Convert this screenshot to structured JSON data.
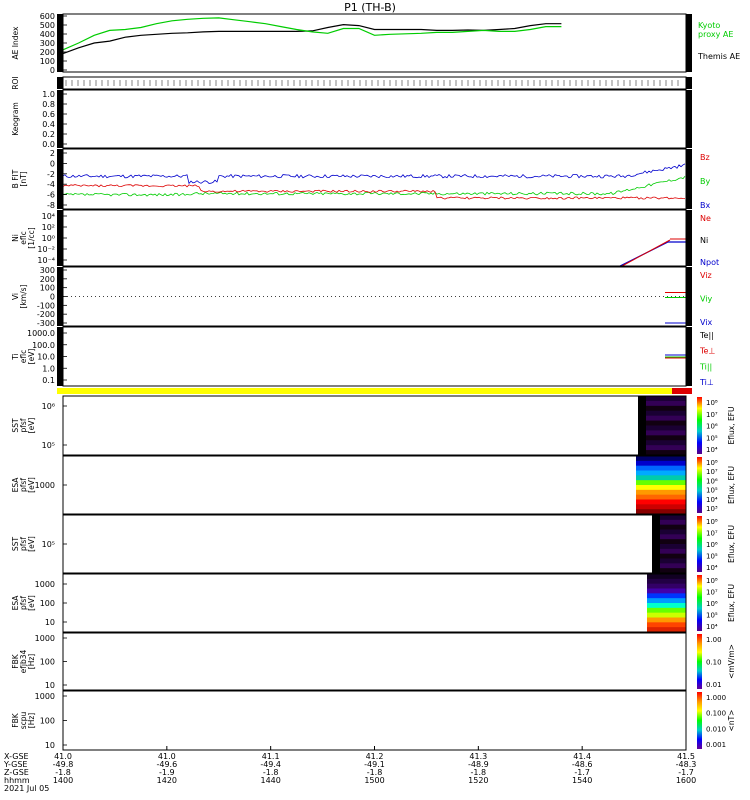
{
  "title": "P1 (TH-B)",
  "colors": {
    "black": "#000000",
    "green": "#00cc00",
    "red": "#dd0000",
    "blue": "#0000cc",
    "yellow": "#ffff00"
  },
  "chart_data": [
    {
      "type": "line",
      "panel": "ae",
      "ylabel": "AE Index",
      "yticks": [
        "600",
        "500",
        "400",
        "300",
        "200",
        "100",
        "0"
      ],
      "ylim": [
        0,
        600
      ],
      "x": [
        1400,
        1405,
        1410,
        1415,
        1420,
        1425,
        1430,
        1435,
        1440,
        1445,
        1450,
        1455,
        1460,
        1465,
        1470,
        1475,
        1480,
        1485,
        1490,
        1495,
        1500,
        1505,
        1510,
        1515,
        1520,
        1525,
        1530,
        1535,
        1540,
        1545,
        1550,
        1555,
        1560
      ],
      "series": [
        {
          "name": "Themis AE",
          "values": [
            190,
            250,
            300,
            320,
            360,
            380,
            390,
            400,
            405,
            415,
            420,
            420,
            420,
            420,
            420,
            420,
            425,
            460,
            490,
            480,
            440,
            440,
            440,
            440,
            430,
            430,
            435,
            430,
            440,
            450,
            480,
            500,
            500
          ]
        },
        {
          "name": "Kyoto proxy AE",
          "values": [
            230,
            300,
            380,
            430,
            440,
            460,
            500,
            530,
            545,
            555,
            560,
            540,
            520,
            500,
            470,
            440,
            415,
            400,
            450,
            450,
            380,
            390,
            395,
            400,
            410,
            410,
            420,
            430,
            420,
            420,
            440,
            470,
            470
          ]
        }
      ],
      "legend": [
        "Kyoto",
        "proxy AE",
        "Themis AE"
      ]
    },
    {
      "type": "bar",
      "panel": "roi",
      "ylabel": "ROI"
    },
    {
      "type": "heatmap",
      "panel": "keogram",
      "ylabel": "Keogram",
      "yticks": [
        "1.0",
        "0.8",
        "0.6",
        "0.4",
        "0.2",
        "0.0"
      ]
    },
    {
      "type": "line",
      "panel": "bfield",
      "ylabel": "B FIT",
      "yunit": "[nT]",
      "yticks": [
        "2",
        "0",
        "-2",
        "-4",
        "-6",
        "-8"
      ],
      "ylim": [
        -8,
        2
      ],
      "legend": [
        "Bz",
        "By",
        "Bx"
      ]
    },
    {
      "type": "line",
      "panel": "density",
      "ylabel": "Ni",
      "ysub": "eflc",
      "yunit": "[1/cc]",
      "yticks": [
        "10⁴",
        "10²",
        "10⁰",
        "10⁻²",
        "10⁻⁴"
      ],
      "legend": [
        "Ne",
        "Ni",
        "Npot"
      ]
    },
    {
      "type": "line",
      "panel": "velocity",
      "ylabel": "Vi",
      "yunit": "[km/s]",
      "yticks": [
        "300",
        "200",
        "100",
        "0",
        "-100",
        "-200",
        "-300"
      ],
      "ylim": [
        -300,
        300
      ],
      "legend": [
        "Viz",
        "Viy",
        "Vix"
      ]
    },
    {
      "type": "line",
      "panel": "temperature",
      "ylabel": "Ti",
      "ysub": "eflc",
      "yunit": "[eV]",
      "yticks": [
        "1000.0",
        "100.0",
        "10.0",
        "1.0",
        "0.1"
      ],
      "legend": [
        "Te||",
        "Te⊥",
        "Ti||",
        "Ti⊥"
      ]
    },
    {
      "type": "heatmap",
      "panel": "sst1",
      "ylabel": "SST",
      "ysub": "pfsf",
      "yunit": "[eV]",
      "yticks": [
        "10⁶",
        "10⁵"
      ],
      "zlabel": "Eflux, EFU",
      "zticks": [
        "10⁸",
        "10⁷",
        "10⁶",
        "10⁵",
        "10⁴"
      ]
    },
    {
      "type": "heatmap",
      "panel": "esa1",
      "ylabel": "ESA",
      "ysub": "pfsf",
      "yunit": "[eV]",
      "yticks": [
        "1000"
      ],
      "zlabel": "Eflux, EFU",
      "zticks": [
        "10⁸",
        "10⁷",
        "10⁶",
        "10⁵",
        "10⁴",
        "10³"
      ]
    },
    {
      "type": "heatmap",
      "panel": "sst2",
      "ylabel": "SST",
      "ysub": "pfsf",
      "yunit": "[eV]",
      "yticks": [
        "10⁵"
      ],
      "zlabel": "Eflux, EFU",
      "zticks": [
        "10⁸",
        "10⁷",
        "10⁶",
        "10⁵",
        "10⁴"
      ]
    },
    {
      "type": "heatmap",
      "panel": "esa2",
      "ylabel": "ESA",
      "ysub": "pfsf",
      "yunit": "[eV]",
      "yticks": [
        "1000",
        "100",
        "10"
      ],
      "zlabel": "Eflux, EFU",
      "zticks": [
        "10⁸",
        "10⁷",
        "10⁶",
        "10⁵",
        "10⁴"
      ]
    },
    {
      "type": "heatmap",
      "panel": "fbk1",
      "ylabel": "FBK",
      "ysub": "efjb34",
      "yunit": "[Hz]",
      "yticks": [
        "1000",
        "100",
        "10"
      ],
      "zlabel": "<mV/m>",
      "zticks": [
        "1.00",
        "0.10",
        "0.01"
      ]
    },
    {
      "type": "heatmap",
      "panel": "fbk2",
      "ylabel": "FBK",
      "ysub": "scpu",
      "yunit": "[Hz]",
      "yticks": [
        "1000",
        "100",
        "10"
      ],
      "zlabel": "<nT>",
      "zticks": [
        "1.000",
        "0.100",
        "0.010",
        "0.001"
      ]
    }
  ],
  "xaxis": {
    "row_labels": [
      "X-GSE",
      "Y-GSE",
      "Z-GSE",
      "hhmm",
      "2021 Jul 05"
    ],
    "columns": [
      {
        "v1": "41.0",
        "v2": "-49.8",
        "v3": "-1.8",
        "t": "1400"
      },
      {
        "v1": "41.0",
        "v2": "-49.6",
        "v3": "-1.9",
        "t": "1420"
      },
      {
        "v1": "41.1",
        "v2": "-49.4",
        "v3": "-1.8",
        "t": "1440"
      },
      {
        "v1": "41.2",
        "v2": "-49.1",
        "v3": "-1.8",
        "t": "1500"
      },
      {
        "v1": "41.3",
        "v2": "-48.9",
        "v3": "-1.8",
        "t": "1520"
      },
      {
        "v1": "41.4",
        "v2": "-48.6",
        "v3": "-1.7",
        "t": "1540"
      },
      {
        "v1": "41.5",
        "v2": "-48.3",
        "v3": "-1.7",
        "t": "1600"
      }
    ]
  }
}
